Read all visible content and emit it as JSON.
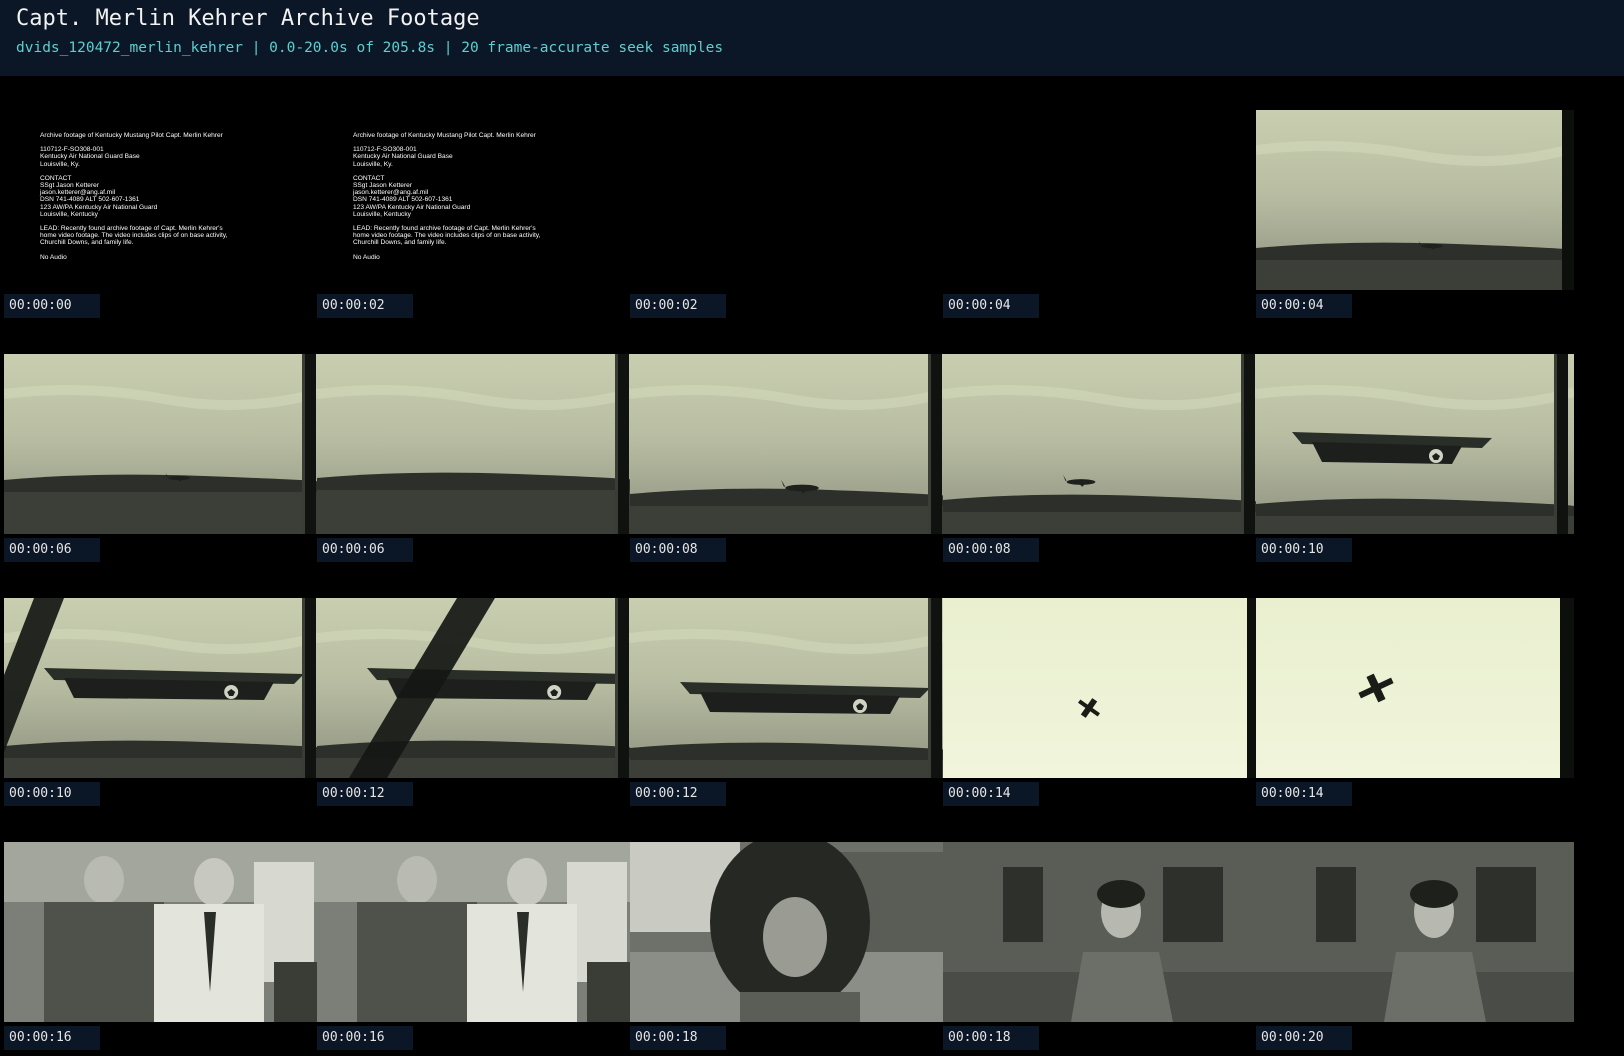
{
  "header": {
    "title": "Capt. Merlin Kehrer Archive Footage",
    "subtitle": "dvids_120472_merlin_kehrer | 0.0-20.0s of 205.8s | 20 frame-accurate seek samples"
  },
  "slate_lines": [
    "Archive footage of Kentucky Mustang Pilot Capt. Merlin Kehrer",
    "",
    "110712-F-SO308-001",
    "Kentucky Air National Guard Base",
    "Louisville, Ky.",
    "",
    "CONTACT",
    "SSgt Jason Ketterer",
    "jason.ketterer@ang.af.mil",
    "DSN 741-4089  ALT 502-607-1361",
    "123 AW/PA Kentucky Air National Guard",
    "Louisville, Kentucky",
    "",
    "LEAD: Recently found archive footage of Capt. Merlin Kehrer's",
    "home video footage. The video includes clips of on base activity,",
    "Churchill Downs, and family life.",
    "",
    "No Audio"
  ],
  "frames": [
    {
      "timestamp": "00:00:00",
      "scene": "slate"
    },
    {
      "timestamp": "00:00:02",
      "scene": "slate"
    },
    {
      "timestamp": "00:00:02",
      "scene": "black"
    },
    {
      "timestamp": "00:00:04",
      "scene": "black"
    },
    {
      "timestamp": "00:00:04",
      "scene": "plane-far-right"
    },
    {
      "timestamp": "00:00:06",
      "scene": "plane-far-left"
    },
    {
      "timestamp": "00:00:06",
      "scene": "runway-empty"
    },
    {
      "timestamp": "00:00:08",
      "scene": "plane-runway"
    },
    {
      "timestamp": "00:00:08",
      "scene": "plane-runway-small"
    },
    {
      "timestamp": "00:00:10",
      "scene": "plane-close"
    },
    {
      "timestamp": "00:00:10",
      "scene": "plane-close-strut"
    },
    {
      "timestamp": "00:00:12",
      "scene": "plane-close-strut-wide"
    },
    {
      "timestamp": "00:00:12",
      "scene": "plane-taxi"
    },
    {
      "timestamp": "00:00:14",
      "scene": "sky-plane-small"
    },
    {
      "timestamp": "00:00:14",
      "scene": "sky-plane-large"
    },
    {
      "timestamp": "00:00:16",
      "scene": "two-men"
    },
    {
      "timestamp": "00:00:16",
      "scene": "two-men"
    },
    {
      "timestamp": "00:00:18",
      "scene": "woman-closeup"
    },
    {
      "timestamp": "00:00:18",
      "scene": "woman-house"
    },
    {
      "timestamp": "00:00:20",
      "scene": "woman-house"
    }
  ]
}
